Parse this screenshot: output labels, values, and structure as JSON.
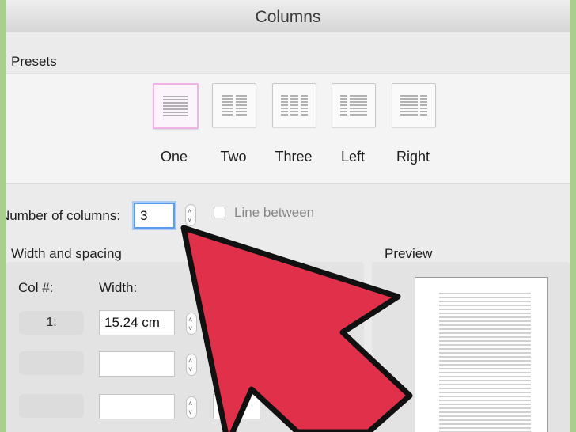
{
  "dialog": {
    "title": "Columns"
  },
  "presets": {
    "title": "Presets",
    "items": [
      {
        "label": "One",
        "selected": true
      },
      {
        "label": "Two",
        "selected": false
      },
      {
        "label": "Three",
        "selected": false
      },
      {
        "label": "Left",
        "selected": false
      },
      {
        "label": "Right",
        "selected": false
      }
    ]
  },
  "columns": {
    "label": "Number of columns:",
    "value": "3",
    "line_between_label": "Line between",
    "line_between_checked": false
  },
  "width_spacing": {
    "title": "Width and spacing",
    "col_header": "Col #:",
    "width_header": "Width:",
    "rows": [
      {
        "col": "1:",
        "width": "15.24 cm"
      },
      {
        "col": "",
        "width": ""
      },
      {
        "col": "",
        "width": ""
      }
    ]
  },
  "preview": {
    "title": "Preview"
  },
  "colors": {
    "arrow_fill": "#e0304a",
    "arrow_stroke": "#111111",
    "focus_ring": "#5b9ce8",
    "selected_preset_border": "#f1b2e8"
  }
}
